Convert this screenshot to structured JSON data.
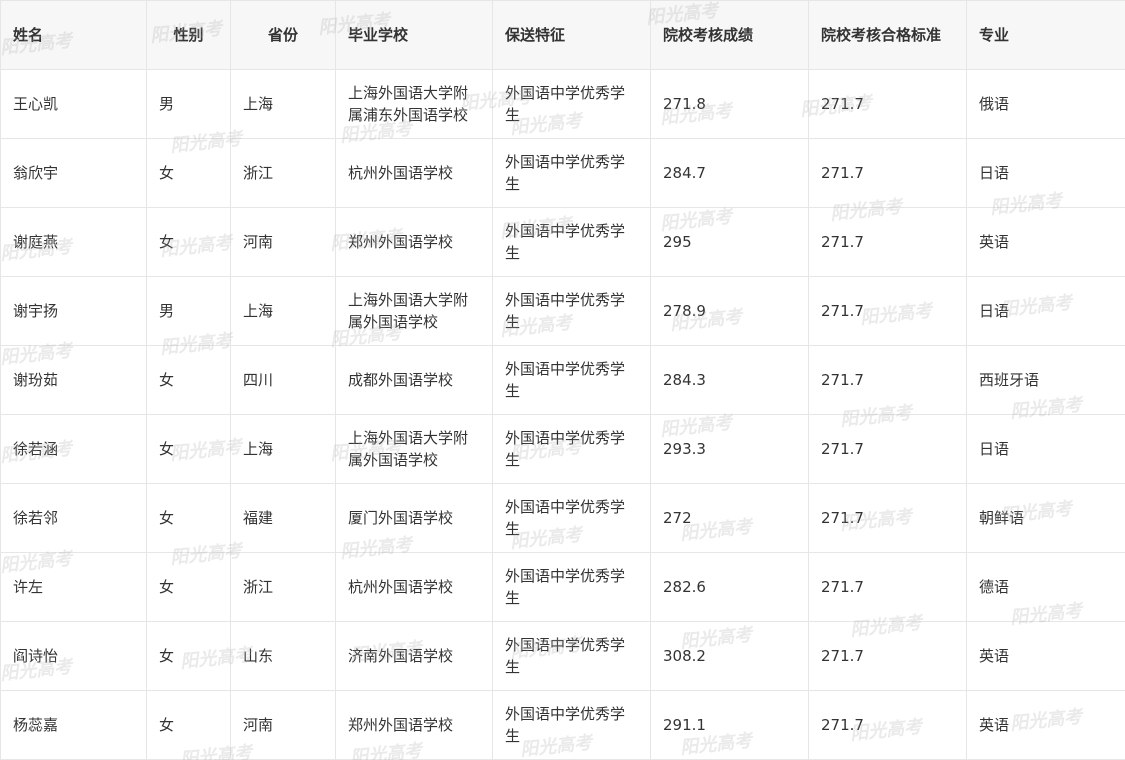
{
  "table": {
    "headers": [
      "姓名",
      "性别",
      "省份",
      "毕业学校",
      "保送特征",
      "院校考核成绩",
      "院校考核合格标准",
      "专业"
    ],
    "rows": [
      [
        "王心凯",
        "男",
        "上海",
        "上海外国语大学附属浦东外国语学校",
        "外国语中学优秀学生",
        "271.8",
        "271.7",
        "俄语"
      ],
      [
        "翁欣宇",
        "女",
        "浙江",
        "杭州外国语学校",
        "外国语中学优秀学生",
        "284.7",
        "271.7",
        "日语"
      ],
      [
        "谢庭燕",
        "女",
        "河南",
        "郑州外国语学校",
        "外国语中学优秀学生",
        "295",
        "271.7",
        "英语"
      ],
      [
        "谢宇扬",
        "男",
        "上海",
        "上海外国语大学附属外国语学校",
        "外国语中学优秀学生",
        "278.9",
        "271.7",
        "日语"
      ],
      [
        "谢玢茹",
        "女",
        "四川",
        "成都外国语学校",
        "外国语中学优秀学生",
        "284.3",
        "271.7",
        "西班牙语"
      ],
      [
        "徐若涵",
        "女",
        "上海",
        "上海外国语大学附属外国语学校",
        "外国语中学优秀学生",
        "293.3",
        "271.7",
        "日语"
      ],
      [
        "徐若邻",
        "女",
        "福建",
        "厦门外国语学校",
        "外国语中学优秀学生",
        "272",
        "271.7",
        "朝鲜语"
      ],
      [
        "许左",
        "女",
        "浙江",
        "杭州外国语学校",
        "外国语中学优秀学生",
        "282.6",
        "271.7",
        "德语"
      ],
      [
        "阎诗怡",
        "女",
        "山东",
        "济南外国语学校",
        "外国语中学优秀学生",
        "308.2",
        "271.7",
        "英语"
      ],
      [
        "杨蕊嘉",
        "女",
        "河南",
        "郑州外国语学校",
        "外国语中学优秀学生",
        "291.1",
        "271.7",
        "英语"
      ]
    ]
  },
  "watermark": {
    "text": "阳光高考"
  },
  "colors": {
    "border": "#e6e6e6",
    "header_bg": "#f7f7f7",
    "text": "#333333"
  }
}
